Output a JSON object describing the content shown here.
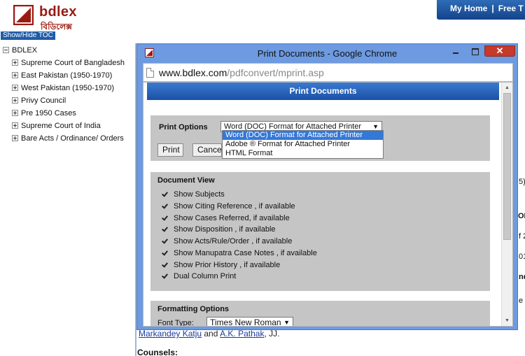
{
  "brand": {
    "name": "bdlex",
    "tagline": "বিডিলেক্স",
    "color": "#9a1a12"
  },
  "toc_toggle": "Show/Hide TOC",
  "topnav": {
    "my_home": "My Home",
    "separator": "|",
    "free": "Free T"
  },
  "toc": {
    "root": "BDLEX",
    "items": [
      "Supreme Court of Bangladesh",
      "East Pakistan (1950-1970)",
      "West Pakistan (1950-1970)",
      "Privy Council",
      "Pre 1950 Cases",
      "Supreme Court of India",
      "Bare Acts / Ordinance/ Orders"
    ]
  },
  "background": {
    "judges": {
      "judge1": "Markandey Katju",
      "and": " and ",
      "judge2": "A.K. Pathak",
      "suffix": ", JJ."
    },
    "counsels": "Counsels:",
    "fragments": [
      "5)F",
      "OI",
      "f 2",
      "01",
      "ndi",
      "e a"
    ]
  },
  "window": {
    "title": "Print Documents - Google Chrome",
    "url_host": "www.bdlex.com",
    "url_path": "/pdfconvert/mprint.asp",
    "close_glyph": "✕",
    "accent": "#6d9ae0"
  },
  "page": {
    "header": "Print Documents",
    "print_options": {
      "label": "Print Options",
      "selected": "Word (DOC) Format for Attached Printer",
      "options": [
        "Word (DOC) Format for Attached Printer",
        "Adobe ® Format for Attached Printer",
        "HTML Format"
      ],
      "print_button": "Print",
      "cancel_button": "Cancel"
    },
    "document_view": {
      "title": "Document View",
      "items": [
        "Show Subjects",
        "Show Citing Reference , if available",
        "Show Cases Referred, if available",
        "Show Disposition , if available",
        "Show Acts/Rule/Order , if available",
        "Show Manupatra Case Notes , if available",
        "Show Prior History , if available",
        "Dual Column Print"
      ]
    },
    "formatting": {
      "title": "Formatting Options",
      "font_label": "Font Type:",
      "font_value": "Times New Roman"
    }
  }
}
